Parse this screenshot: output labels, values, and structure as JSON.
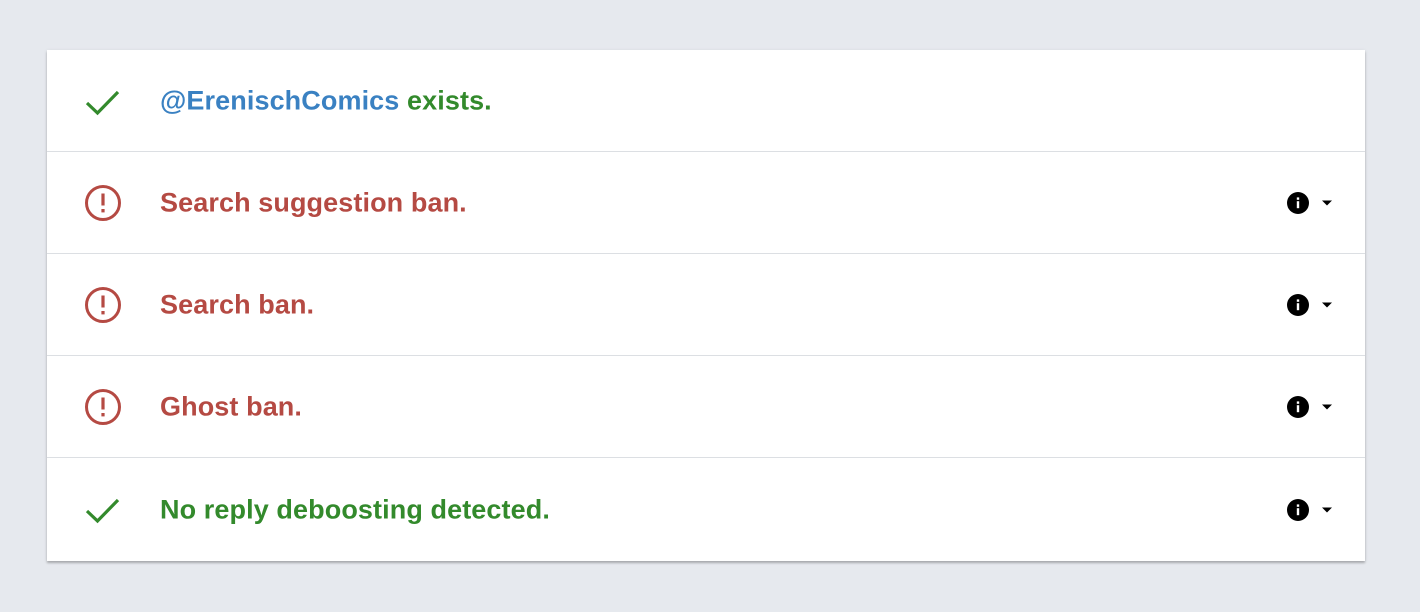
{
  "colors": {
    "success": "#338a2c",
    "error": "#b54a43",
    "handle": "#3a81c2",
    "background": "#e6e9ee"
  },
  "results": [
    {
      "status": "success",
      "icon": "check-icon",
      "handle": "@ErenischComics",
      "label": " exists."
    },
    {
      "status": "error",
      "icon": "alert-circle-icon",
      "label": "Search suggestion ban.",
      "info_icon": "info-icon",
      "toggle_icon": "caret-down-icon"
    },
    {
      "status": "error",
      "icon": "alert-circle-icon",
      "label": "Search ban.",
      "info_icon": "info-icon",
      "toggle_icon": "caret-down-icon"
    },
    {
      "status": "error",
      "icon": "alert-circle-icon",
      "label": "Ghost ban.",
      "info_icon": "info-icon",
      "toggle_icon": "caret-down-icon"
    },
    {
      "status": "success",
      "icon": "check-icon",
      "label": "No reply deboosting detected.",
      "info_icon": "info-icon",
      "toggle_icon": "caret-down-icon"
    }
  ]
}
